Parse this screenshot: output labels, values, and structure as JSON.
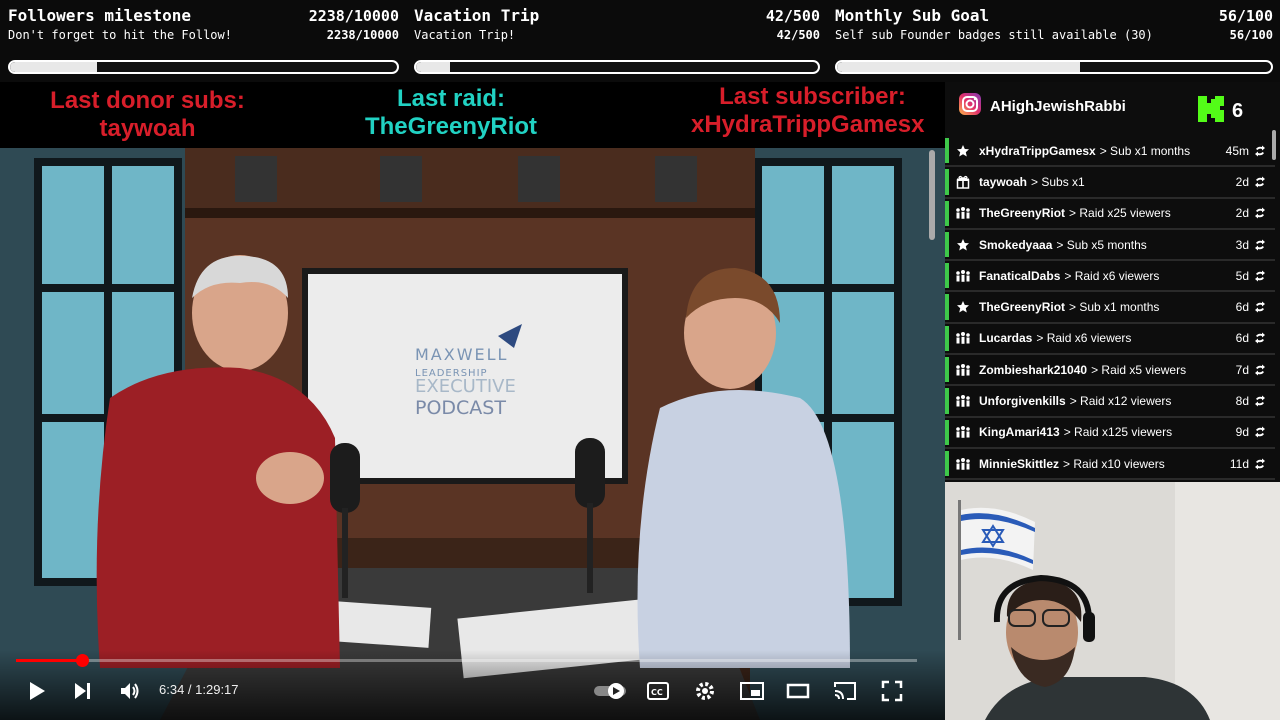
{
  "goals": [
    {
      "title": "Followers milestone",
      "count": "2238/10000",
      "subtitle": "Don't forget to hit the Follow!",
      "count_small": "2238/10000",
      "progress": 0.2238
    },
    {
      "title": "Vacation Trip",
      "count": "42/500",
      "subtitle": "Vacation Trip!",
      "count_small": "42/500",
      "progress": 0.084
    },
    {
      "title": "Monthly Sub Goal",
      "count": "56/100",
      "subtitle": "Self sub Founder badges still available (30)",
      "count_small": "56/100",
      "progress": 0.56
    }
  ],
  "alerts": {
    "donor_label": "Last donor subs:",
    "donor_value": "taywoah",
    "raid_label": "Last raid:",
    "raid_value": "TheGreenyRiot",
    "sub_label": "Last subscriber:",
    "sub_value": "xHydraTrippGamesx"
  },
  "social": {
    "instagram_handle": "AHighJewishRabbi",
    "kick_viewers": "6"
  },
  "events": [
    {
      "user": "xHydraTrippGamesx",
      "action": "> Sub x1 months",
      "when": "45m",
      "icon": "star-icon"
    },
    {
      "user": "taywoah",
      "action": "> Subs x1",
      "when": "2d",
      "icon": "gift-icon"
    },
    {
      "user": "TheGreenyRiot",
      "action": "> Raid x25 viewers",
      "when": "2d",
      "icon": "raid-icon"
    },
    {
      "user": "Smokedyaaa",
      "action": "> Sub x5 months",
      "when": "3d",
      "icon": "star-icon"
    },
    {
      "user": "FanaticalDabs",
      "action": "> Raid x6 viewers",
      "when": "5d",
      "icon": "raid-icon"
    },
    {
      "user": "TheGreenyRiot",
      "action": "> Sub x1 months",
      "when": "6d",
      "icon": "star-icon"
    },
    {
      "user": "Lucardas",
      "action": "> Raid x6 viewers",
      "when": "6d",
      "icon": "raid-icon"
    },
    {
      "user": "Zombieshark21040",
      "action": "> Raid x5 viewers",
      "when": "7d",
      "icon": "raid-icon"
    },
    {
      "user": "Unforgivenkills",
      "action": "> Raid x12 viewers",
      "when": "8d",
      "icon": "raid-icon"
    },
    {
      "user": "KingAmari413",
      "action": "> Raid x125 viewers",
      "when": "9d",
      "icon": "raid-icon"
    },
    {
      "user": "MinnieSkittlez",
      "action": "> Raid x10 viewers",
      "when": "11d",
      "icon": "raid-icon"
    }
  ],
  "video": {
    "time": "6:34 / 1:29:17",
    "progress": 0.0735,
    "screen_line1": "MAXWELL",
    "screen_line2": "LEADERSHIP",
    "screen_line3": "EXECUTIVE",
    "screen_line4": "PODCAST"
  },
  "colors": {
    "accent_red": "#d81e2a",
    "accent_teal": "#21d2c3",
    "event_green": "#3ec84a",
    "kick_green": "#53fc18"
  }
}
